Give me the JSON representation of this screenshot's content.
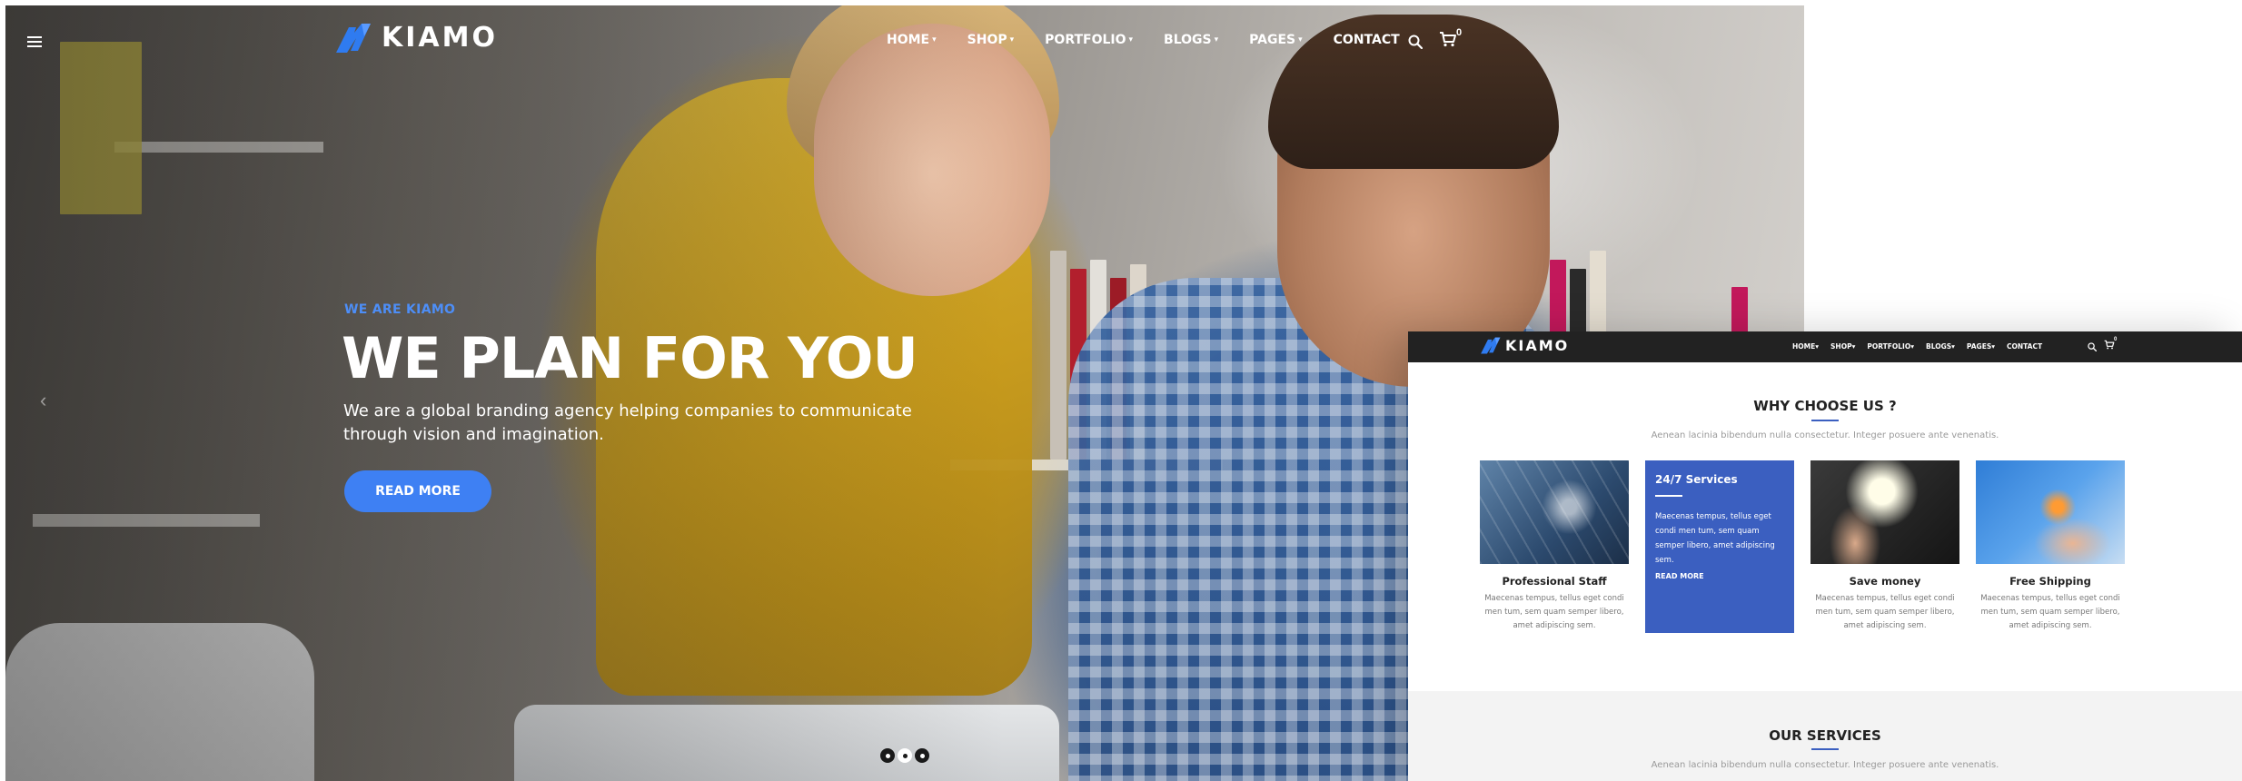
{
  "hero": {
    "logo_text": "KIAMO",
    "nav": [
      {
        "label": "HOME",
        "has_dropdown": true
      },
      {
        "label": "SHOP",
        "has_dropdown": true
      },
      {
        "label": "PORTFOLIO",
        "has_dropdown": true
      },
      {
        "label": "BLOGS",
        "has_dropdown": true
      },
      {
        "label": "PAGES",
        "has_dropdown": true
      },
      {
        "label": "CONTACT",
        "has_dropdown": false
      }
    ],
    "cart_count": "0",
    "eyebrow": "WE ARE KIAMO",
    "title": "WE PLAN FOR YOU",
    "subtitle": "We are a global branding agency helping companies to communicate through vision and imagination.",
    "cta_label": "READ MORE",
    "slider_dots": 3,
    "active_dot": 1,
    "icons": [
      "hamburger-menu-icon",
      "search-icon",
      "cart-icon",
      "chevron-left-icon"
    ]
  },
  "panel": {
    "logo_text": "KIAMO",
    "nav": [
      "HOME",
      "SHOP",
      "PORTFOLIO",
      "BLOGS",
      "PAGES",
      "CONTACT"
    ],
    "nav_carets": [
      "▾",
      "▾",
      "▾",
      "▾",
      "▾",
      ""
    ],
    "cart_count": "0",
    "why": {
      "title": "WHY CHOOSE US ?",
      "subtitle": "Aenean lacinia bibendum nulla consectetur. Integer posuere ante venenatis."
    },
    "cards": [
      {
        "title": "Professional Staff",
        "text": "Maecenas tempus, tellus eget condi men tum, sem quam semper libero, amet adipiscing sem."
      },
      {
        "title": "24/7 Services",
        "text": "Maecenas tempus, tellus eget condi men tum, sem quam semper libero, amet adipiscing sem.",
        "link": "READ MORE"
      },
      {
        "title": "Save money",
        "text": "Maecenas tempus, tellus eget condi men tum, sem quam semper libero, amet adipiscing sem."
      },
      {
        "title": "Free Shipping",
        "text": "Maecenas tempus, tellus eget condi men tum, sem quam semper libero, amet adipiscing sem."
      }
    ],
    "services": {
      "title": "OUR SERVICES",
      "subtitle": "Aenean lacinia bibendum nulla consectetur. Integer posuere ante venenatis."
    }
  },
  "colors": {
    "accent_blue": "#3e80f3",
    "card_blue": "#3b5fc0",
    "header_dark": "#222222",
    "logo_blue": "#2f7bf0"
  }
}
